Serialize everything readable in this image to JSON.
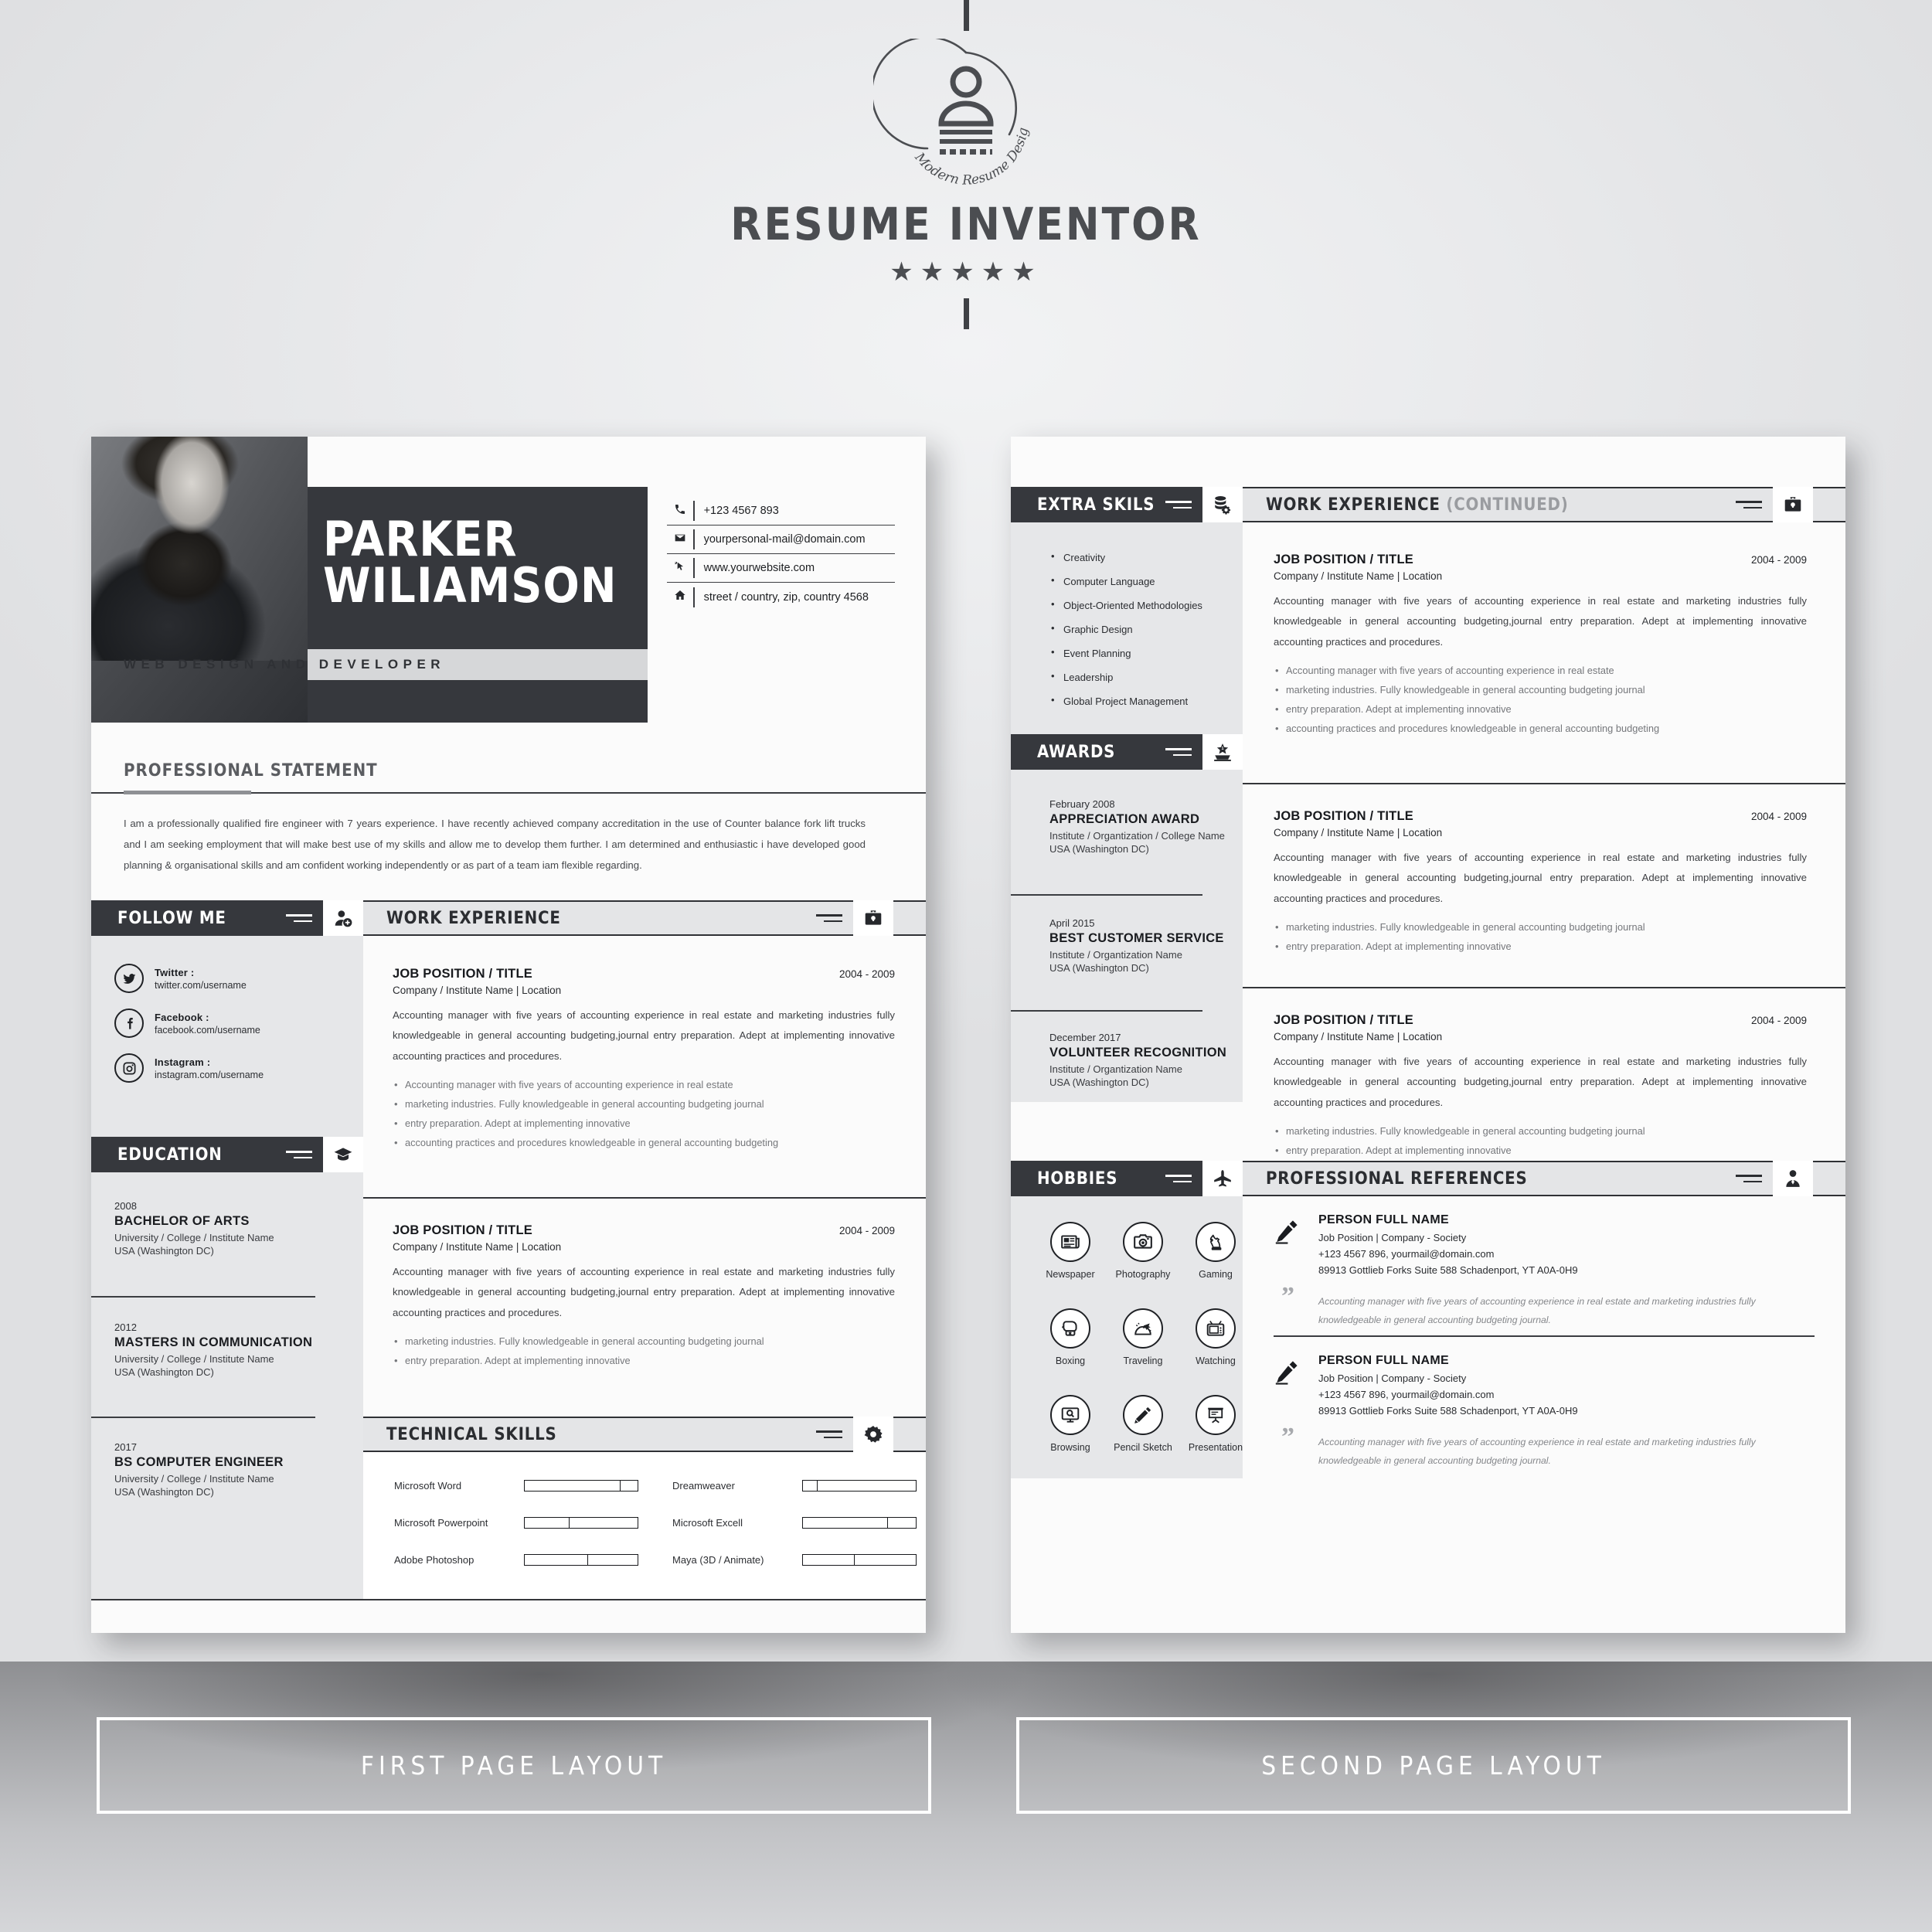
{
  "brand": {
    "title": "RESUME INVENTOR",
    "tagline": "Modern Resume Design",
    "stars": "★★★★★"
  },
  "page1": {
    "name_line1": "PARKER",
    "name_line2": "WILIAMSON",
    "role": "WEB DESIGN AND DEVELOPER",
    "contacts": [
      {
        "icon": "phone-icon",
        "glyph": "✆",
        "value": "+123 4567 893"
      },
      {
        "icon": "envelope-icon",
        "glyph": "✉",
        "value": "yourpersonal-mail@domain.com"
      },
      {
        "icon": "cursor-icon",
        "glyph": "➤",
        "value": "www.yourwebsite.com"
      },
      {
        "icon": "home-icon",
        "glyph": "⌂",
        "value": "street / country, zip, country 4568"
      }
    ],
    "statement": {
      "heading": "PROFESSIONAL STATEMENT",
      "body": "I am a professionally qualified fire engineer with 7 years experience. I have recently achieved company accreditation in the use of Counter balance fork lift trucks and I am seeking employment that will make best use of my skills and allow me to develop them further. I am determined and enthusiastic i have developed good planning & organisational skills and am confident working independently or as part of a team iam flexible regarding."
    },
    "follow_me": {
      "title": "FOLLOW ME",
      "icon": "user-add-icon",
      "items": [
        {
          "icon": "twitter-icon",
          "label": "Twitter :",
          "url": "twitter.com/username"
        },
        {
          "icon": "facebook-icon",
          "label": "Facebook :",
          "url": "facebook.com/username"
        },
        {
          "icon": "instagram-icon",
          "label": "Instagram :",
          "url": "instagram.com/username"
        }
      ]
    },
    "education": {
      "title": "EDUCATION",
      "icon": "graduation-cap-icon",
      "items": [
        {
          "year": "2008",
          "degree": "BACHELOR OF ARTS",
          "school": "University / College / Institute Name",
          "location": "USA (Washington DC)"
        },
        {
          "year": "2012",
          "degree": "MASTERS IN COMMUNICATION",
          "school": "University / College / Institute Name",
          "location": "USA (Washington DC)"
        },
        {
          "year": "2017",
          "degree": "BS COMPUTER  ENGINEER",
          "school": "University / College / Institute Name",
          "location": "USA (Washington DC)"
        }
      ]
    },
    "work": {
      "title": "WORK EXPERIENCE",
      "icon": "briefcase-icon",
      "items": [
        {
          "title": "JOB POSITION / TITLE",
          "date": "2004 - 2009",
          "company": "Company / Institute Name  |  Location",
          "description": "Accounting manager with five years of accounting experience in real estate and marketing industries fully knowledgeable in general accounting budgeting,journal entry preparation. Adept at implementing innovative accounting practices and procedures.",
          "bullets": [
            "Accounting manager with five years of accounting experience in real estate",
            "marketing industries. Fully knowledgeable in general accounting budgeting journal",
            "entry preparation. Adept at implementing innovative",
            "accounting practices and procedures knowledgeable in general accounting budgeting"
          ]
        },
        {
          "title": "JOB POSITION / TITLE",
          "date": "2004 - 2009",
          "company": "Company / Institute Name  |  Location",
          "description": "Accounting manager with five years of accounting experience in real estate and marketing industries fully knowledgeable in general accounting budgeting,journal entry preparation. Adept at implementing innovative accounting practices and procedures.",
          "bullets": [
            "marketing industries. Fully knowledgeable in general accounting budgeting journal",
            "entry preparation. Adept at implementing innovative"
          ]
        }
      ]
    },
    "technical_skills": {
      "title": "TECHNICAL SKILLS",
      "icon": "gear-icon",
      "items": [
        {
          "name": "Microsoft Word",
          "level": 85
        },
        {
          "name": "Dreamweaver",
          "level": 13
        },
        {
          "name": "Microsoft Powerpoint",
          "level": 40
        },
        {
          "name": "Microsoft Excell",
          "level": 75
        },
        {
          "name": "Adobe Photoshop",
          "level": 56
        },
        {
          "name": "Maya (3D / Animate)",
          "level": 46
        }
      ]
    }
  },
  "page2": {
    "extra_skills": {
      "title": "EXTRA SKILS",
      "icon": "database-gear-icon",
      "items": [
        "Creativity",
        "Computer Language",
        "Object-Oriented Methodologies",
        "Graphic Design",
        "Event Planning",
        "Leadership",
        "Global Project Management"
      ]
    },
    "awards": {
      "title": "AWARDS",
      "icon": "award-podium-icon",
      "items": [
        {
          "date": "February 2008",
          "name": "APPRECIATION AWARD",
          "org": "Institute / Organtization / College Name",
          "location": "USA (Washington DC)"
        },
        {
          "date": "April 2015",
          "name": "BEST CUSTOMER SERVICE",
          "org": "Institute / Organtization Name",
          "location": "USA (Washington DC)"
        },
        {
          "date": "December 2017",
          "name": "VOLUNTEER RECOGNITION",
          "org": "Institute / Organtization Name",
          "location": "USA (Washington DC)"
        }
      ]
    },
    "hobbies": {
      "title": "HOBBIES",
      "icon": "airplane-icon",
      "items": [
        {
          "icon": "newspaper-icon",
          "label": "Newspaper"
        },
        {
          "icon": "camera-icon",
          "label": "Photography"
        },
        {
          "icon": "chess-knight-icon",
          "label": "Gaming"
        },
        {
          "icon": "boxing-glove-icon",
          "label": "Boxing"
        },
        {
          "icon": "travel-plane-icon",
          "label": "Traveling"
        },
        {
          "icon": "television-icon",
          "label": "Watching"
        },
        {
          "icon": "monitor-search-icon",
          "label": "Browsing"
        },
        {
          "icon": "pencil-icon",
          "label": "Pencil Sketch"
        },
        {
          "icon": "presentation-board-icon",
          "label": "Presentation"
        }
      ]
    },
    "work": {
      "title": "WORK EXPERIENCE ",
      "title_muted": "(CONTINUED)",
      "icon": "briefcase-icon",
      "items": [
        {
          "title": "JOB POSITION / TITLE",
          "date": "2004 - 2009",
          "company": "Company / Institute Name  |  Location",
          "description": "Accounting manager with five years of accounting experience in real estate and marketing industries fully knowledgeable in general accounting budgeting,journal entry preparation. Adept at implementing innovative accounting practices and procedures.",
          "bullets": [
            "Accounting manager with five years of accounting experience in real estate",
            "marketing industries. Fully knowledgeable in general accounting budgeting journal",
            "entry preparation. Adept at implementing innovative",
            "accounting practices and procedures knowledgeable in general accounting budgeting"
          ]
        },
        {
          "title": "JOB POSITION / TITLE",
          "date": "2004 - 2009",
          "company": "Company / Institute Name  |  Location",
          "description": "Accounting manager with five years of accounting experience in real estate and marketing industries fully knowledgeable in general accounting budgeting,journal entry preparation. Adept at implementing innovative accounting practices and procedures.",
          "bullets": [
            "marketing industries. Fully knowledgeable in general accounting budgeting journal",
            "entry preparation. Adept at implementing innovative"
          ]
        },
        {
          "title": "JOB POSITION / TITLE",
          "date": "2004 - 2009",
          "company": "Company / Institute Name  |  Location",
          "description": "Accounting manager with five years of accounting experience in real estate and marketing industries fully knowledgeable in general accounting budgeting,journal entry preparation. Adept at implementing innovative accounting practices and procedures.",
          "bullets": [
            "marketing industries. Fully knowledgeable in general accounting budgeting journal",
            "entry preparation. Adept at implementing innovative"
          ]
        }
      ]
    },
    "references": {
      "title": "PROFESSIONAL REFERENCES",
      "icon": "person-tie-icon",
      "items": [
        {
          "name": "PERSON FULL NAME",
          "position": "Job Position   |   Company - Society",
          "contact": "+123 4567 896, yourmail@domain.com",
          "address": "89913 Gottlieb Forks Suite 588 Schadenport, YT A0A-0H9",
          "quote": "Accounting manager with five years of accounting experience in real estate and marketing industries fully knowledgeable in general accounting budgeting journal."
        },
        {
          "name": "PERSON FULL NAME",
          "position": "Job Position   |   Company - Society",
          "contact": "+123 4567 896, yourmail@domain.com",
          "address": "89913 Gottlieb Forks Suite 588 Schadenport, YT A0A-0H9",
          "quote": "Accounting manager with five years of accounting experience in real estate and marketing industries fully knowledgeable in general accounting budgeting journal."
        }
      ]
    }
  },
  "captions": {
    "first": "FIRST PAGE LAYOUT",
    "second": "SECOND PAGE LAYOUT"
  },
  "colors": {
    "dark": "#36383d",
    "light_bar": "#e4e5e7",
    "panel": "#e6e7e9",
    "paper": "#fbfbfb"
  }
}
